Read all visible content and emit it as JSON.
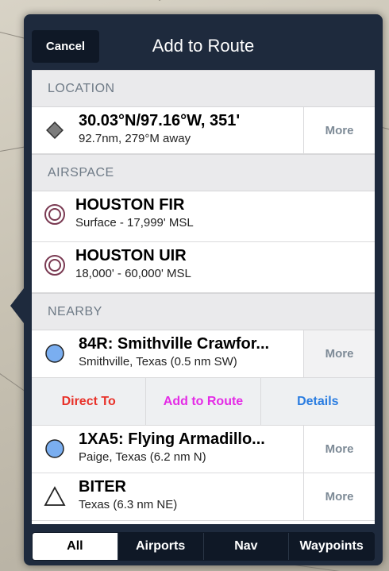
{
  "header": {
    "cancel_label": "Cancel",
    "title": "Add to Route"
  },
  "sections": {
    "location": "LOCATION",
    "airspace": "AIRSPACE",
    "nearby": "NEARBY"
  },
  "location": {
    "main": "30.03°N/97.16°W, 351'",
    "sub": "92.7nm, 279°M away",
    "more": "More",
    "icon": "diamond-icon"
  },
  "airspace": [
    {
      "name": "HOUSTON FIR",
      "range": "Surface - 17,999' MSL",
      "icon": "airspace-ring-icon"
    },
    {
      "name": "HOUSTON UIR",
      "range": "18,000' - 60,000' MSL",
      "icon": "airspace-ring-icon"
    }
  ],
  "nearby": [
    {
      "name": "84R: Smithville Crawfor...",
      "place": "Smithville, Texas  (0.5 nm SW)",
      "more": "More",
      "icon": "airport-circle-icon"
    },
    {
      "name": "1XA5: Flying Armadillo...",
      "place": "Paige, Texas  (6.2 nm N)",
      "more": "More",
      "icon": "airport-circle-icon"
    },
    {
      "name": "BITER",
      "place": "Texas  (6.3 nm NE)",
      "more": "More",
      "icon": "waypoint-triangle-icon"
    }
  ],
  "actions": {
    "direct_to": "Direct To",
    "add_to_route": "Add to Route",
    "details": "Details"
  },
  "tabs": {
    "selected": "All",
    "items": [
      "All",
      "Airports",
      "Nav",
      "Waypoints"
    ]
  },
  "colors": {
    "panel": "#1e2a3d",
    "direct_to": "#e8322a",
    "add_to_route": "#e42be6",
    "details": "#2a7de1",
    "airport_fill": "#7aaef0",
    "airspace_ring": "#7a3a52"
  }
}
